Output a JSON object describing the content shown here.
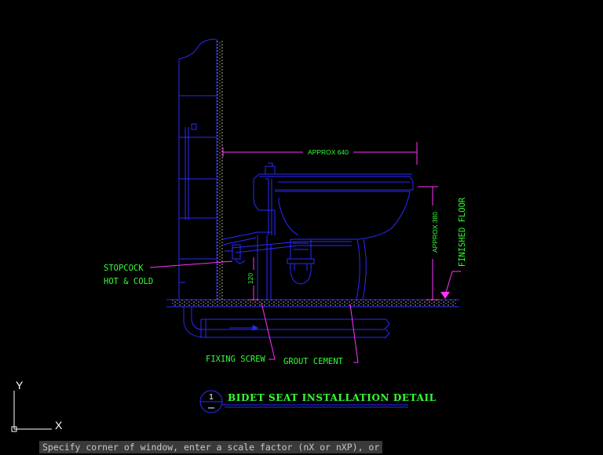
{
  "labels": {
    "approx_640": "APPROX 640",
    "approx_380": "APPROX 380",
    "finished_floor": "FINISHED FLOOR",
    "stopcock_line1": "STOPCOCK",
    "stopcock_line2": "HOT & COLD",
    "dim_120": "120",
    "fixing_screw": "FIXING SCREW",
    "grout_cement": "GROUT CEMENT"
  },
  "title_block": {
    "number": "1",
    "title": "BIDET SEAT INSTALLATION DETAIL"
  },
  "ucs_icon": {
    "y_label": "Y",
    "x_label": "X"
  },
  "command_line": {
    "text": "Specify corner of window, enter a scale factor (nX or nXP), or"
  },
  "colors": {
    "background": "#000000",
    "geometry": "#2a2aff",
    "text": "#33ff33",
    "leader": "#ff33ff",
    "hatch": "#c8c8a0"
  }
}
